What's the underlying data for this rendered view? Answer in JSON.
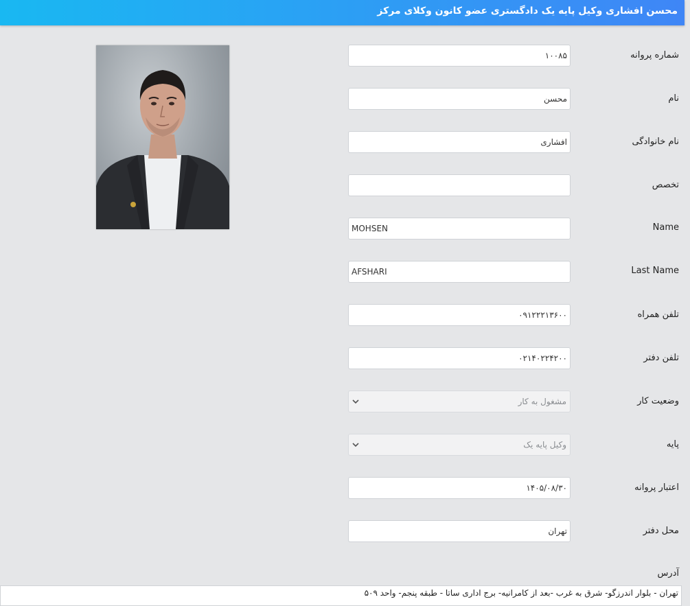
{
  "header": {
    "title": "محسن افشاری وکیل پایه یک دادگستری عضو کانون وکلای مرکز",
    "gradient_start": "#19b8f2",
    "gradient_end": "#3f86f6"
  },
  "photo": {
    "alt": "portrait"
  },
  "fields": {
    "license_number": {
      "label": "شماره پروانه",
      "value": "۱۰۰۸۵"
    },
    "first_name": {
      "label": "نام",
      "value": "محسن"
    },
    "last_name_fa": {
      "label": "نام خانوادگی",
      "value": "افشاری"
    },
    "specialty": {
      "label": "تخصص",
      "value": ""
    },
    "name_en": {
      "label": "Name",
      "value": "MOHSEN"
    },
    "last_name_en": {
      "label": "Last Name",
      "value": "AFSHARI"
    },
    "mobile": {
      "label": "تلفن همراه",
      "value": "۰۹۱۲۲۲۱۳۶۰۰"
    },
    "office_phone": {
      "label": "تلفن دفتر",
      "value": "۰۲۱۴۰۲۲۴۲۰۰"
    },
    "work_status": {
      "label": "وضعیت کار",
      "value": "مشغول به کار"
    },
    "grade": {
      "label": "پایه",
      "value": "وکیل پایه یک"
    },
    "license_validity": {
      "label": "اعتبار پروانه",
      "value": "۱۴۰۵/۰۸/۳۰"
    },
    "office_location": {
      "label": "محل دفتر",
      "value": "تهران"
    },
    "address": {
      "label": "آدرس",
      "value": "تهران - بلوار اندرزگو- شرق به غرب -بعد از کامرانیه- برج اداری ساتا - طبقه پنجم- واحد ۵۰۹"
    }
  }
}
